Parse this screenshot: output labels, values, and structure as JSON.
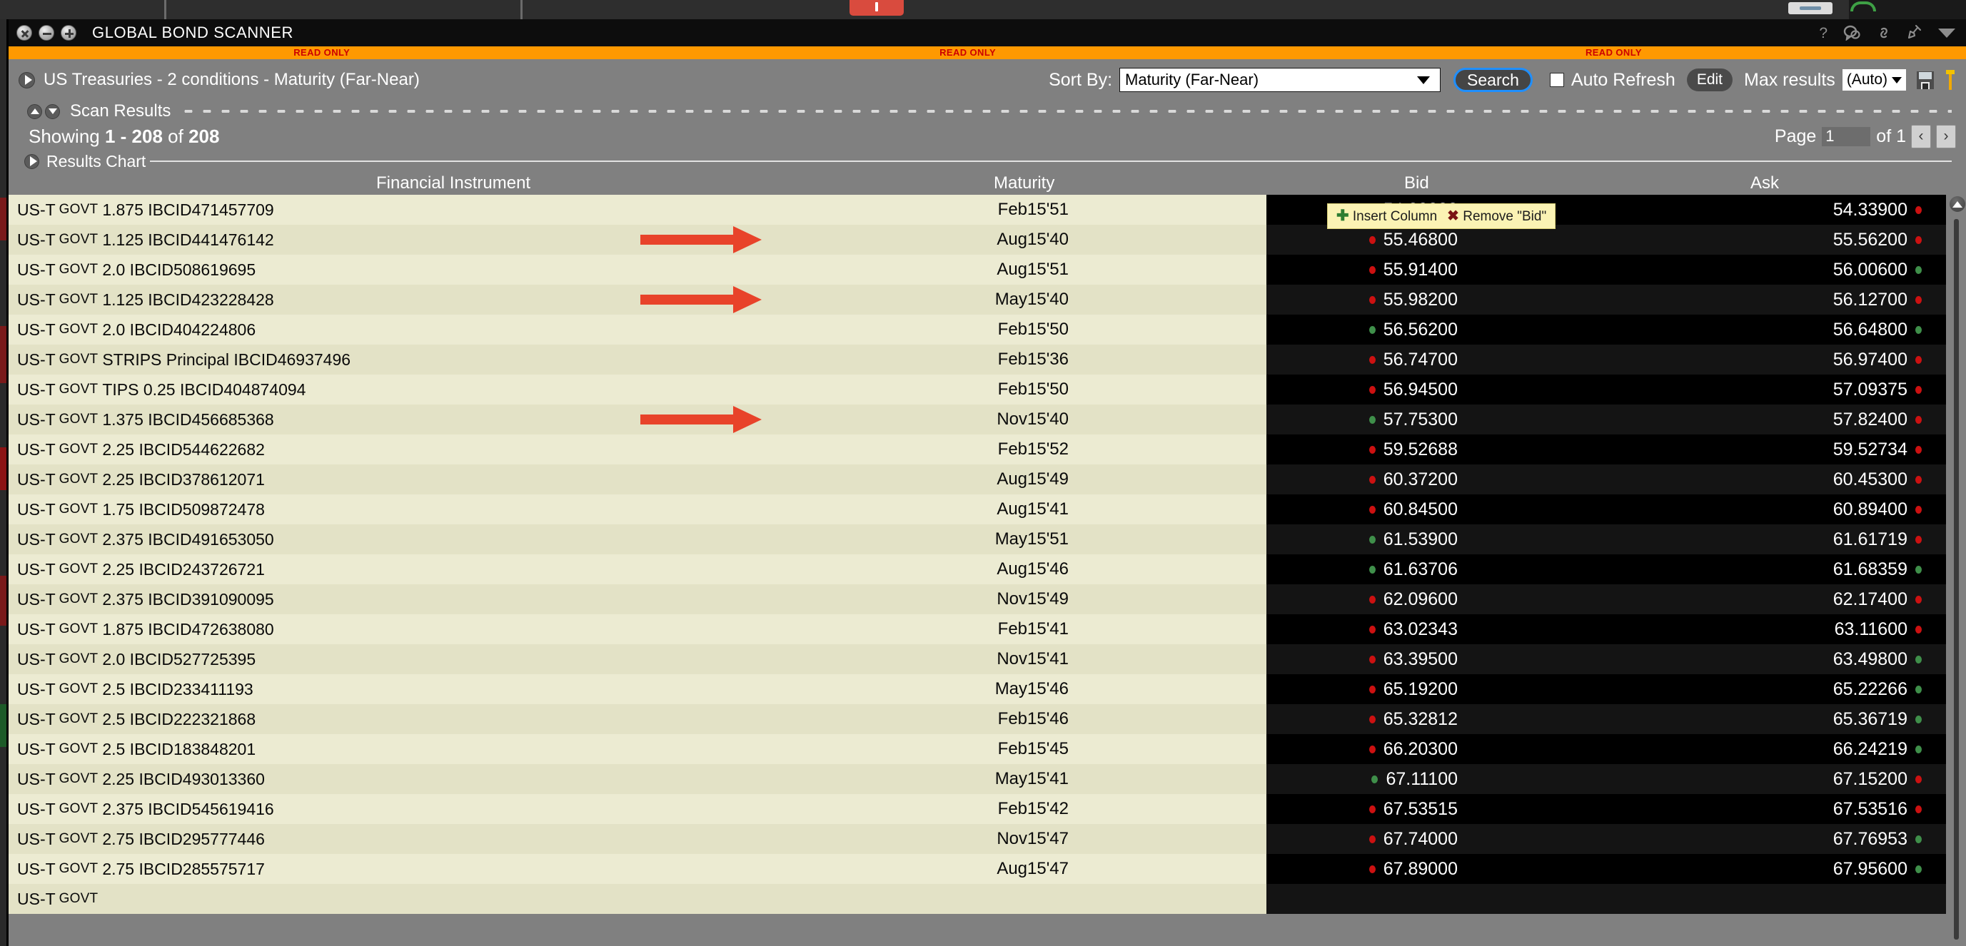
{
  "window": {
    "title": "GLOBAL BOND SCANNER",
    "readonly_label": "READ ONLY",
    "titlebar_icons": [
      "help-icon",
      "chat-icon",
      "link-icon",
      "pin-icon",
      "chevron-down-icon"
    ]
  },
  "toolbar": {
    "scan_title": "US Treasuries - 2 conditions - Maturity (Far-Near)",
    "sort_label": "Sort By:",
    "sort_value": "Maturity (Far-Near)",
    "search_label": "Search",
    "auto_refresh_label": "Auto Refresh",
    "auto_refresh_checked": false,
    "edit_label": "Edit",
    "max_results_label": "Max results",
    "max_results_value": "(Auto)"
  },
  "scan": {
    "results_label": "Scan Results",
    "showing_prefix": "Showing ",
    "showing_range": "1 - 208",
    "showing_mid": " of ",
    "showing_total": "208",
    "chart_label": "Results Chart"
  },
  "pagination": {
    "page_label": "Page",
    "page_value": "1",
    "of_label": "of 1",
    "prev_glyph": "‹",
    "next_glyph": "›"
  },
  "tooltip": {
    "insert_label": "Insert Column",
    "remove_label": "Remove \"Bid\"",
    "plus_glyph": "✚",
    "x_glyph": "✖"
  },
  "table": {
    "headers": {
      "instrument": "Financial Instrument",
      "maturity": "Maturity",
      "bid": "Bid",
      "ask": "Ask"
    },
    "rows": [
      {
        "prefix": "US-T",
        "kind": "GOVT",
        "rest": "1.875 IBCID471457709",
        "maturity": "Feb15'51",
        "bid": "54.29000",
        "bid_dir": "down",
        "ask": "54.33900",
        "ask_dir": "down"
      },
      {
        "prefix": "US-T",
        "kind": "GOVT",
        "rest": "1.125 IBCID441476142",
        "maturity": "Aug15'40",
        "bid": "55.46800",
        "bid_dir": "down",
        "ask": "55.56200",
        "ask_dir": "down"
      },
      {
        "prefix": "US-T",
        "kind": "GOVT",
        "rest": "2.0 IBCID508619695",
        "maturity": "Aug15'51",
        "bid": "55.91400",
        "bid_dir": "down",
        "ask": "56.00600",
        "ask_dir": "up"
      },
      {
        "prefix": "US-T",
        "kind": "GOVT",
        "rest": "1.125 IBCID423228428",
        "maturity": "May15'40",
        "bid": "55.98200",
        "bid_dir": "down",
        "ask": "56.12700",
        "ask_dir": "down"
      },
      {
        "prefix": "US-T",
        "kind": "GOVT",
        "rest": "2.0 IBCID404224806",
        "maturity": "Feb15'50",
        "bid": "56.56200",
        "bid_dir": "up",
        "ask": "56.64800",
        "ask_dir": "up"
      },
      {
        "prefix": "US-T",
        "kind": "GOVT",
        "rest": "STRIPS Principal IBCID46937496",
        "maturity": "Feb15'36",
        "bid": "56.74700",
        "bid_dir": "down",
        "ask": "56.97400",
        "ask_dir": "down"
      },
      {
        "prefix": "US-T",
        "kind": "GOVT",
        "rest": "TIPS 0.25 IBCID404874094",
        "maturity": "Feb15'50",
        "bid": "56.94500",
        "bid_dir": "down",
        "ask": "57.09375",
        "ask_dir": "down"
      },
      {
        "prefix": "US-T",
        "kind": "GOVT",
        "rest": "1.375 IBCID456685368",
        "maturity": "Nov15'40",
        "bid": "57.75300",
        "bid_dir": "up",
        "ask": "57.82400",
        "ask_dir": "down"
      },
      {
        "prefix": "US-T",
        "kind": "GOVT",
        "rest": "2.25 IBCID544622682",
        "maturity": "Feb15'52",
        "bid": "59.52688",
        "bid_dir": "down",
        "ask": "59.52734",
        "ask_dir": "down"
      },
      {
        "prefix": "US-T",
        "kind": "GOVT",
        "rest": "2.25 IBCID378612071",
        "maturity": "Aug15'49",
        "bid": "60.37200",
        "bid_dir": "down",
        "ask": "60.45300",
        "ask_dir": "down"
      },
      {
        "prefix": "US-T",
        "kind": "GOVT",
        "rest": "1.75 IBCID509872478",
        "maturity": "Aug15'41",
        "bid": "60.84500",
        "bid_dir": "down",
        "ask": "60.89400",
        "ask_dir": "down"
      },
      {
        "prefix": "US-T",
        "kind": "GOVT",
        "rest": "2.375 IBCID491653050",
        "maturity": "May15'51",
        "bid": "61.53900",
        "bid_dir": "up",
        "ask": "61.61719",
        "ask_dir": "down"
      },
      {
        "prefix": "US-T",
        "kind": "GOVT",
        "rest": "2.25 IBCID243726721",
        "maturity": "Aug15'46",
        "bid": "61.63706",
        "bid_dir": "up",
        "ask": "61.68359",
        "ask_dir": "up"
      },
      {
        "prefix": "US-T",
        "kind": "GOVT",
        "rest": "2.375 IBCID391090095",
        "maturity": "Nov15'49",
        "bid": "62.09600",
        "bid_dir": "down",
        "ask": "62.17400",
        "ask_dir": "down"
      },
      {
        "prefix": "US-T",
        "kind": "GOVT",
        "rest": "1.875 IBCID472638080",
        "maturity": "Feb15'41",
        "bid": "63.02343",
        "bid_dir": "down",
        "ask": "63.11600",
        "ask_dir": "down"
      },
      {
        "prefix": "US-T",
        "kind": "GOVT",
        "rest": "2.0 IBCID527725395",
        "maturity": "Nov15'41",
        "bid": "63.39500",
        "bid_dir": "down",
        "ask": "63.49800",
        "ask_dir": "up"
      },
      {
        "prefix": "US-T",
        "kind": "GOVT",
        "rest": "2.5 IBCID233411193",
        "maturity": "May15'46",
        "bid": "65.19200",
        "bid_dir": "down",
        "ask": "65.22266",
        "ask_dir": "up"
      },
      {
        "prefix": "US-T",
        "kind": "GOVT",
        "rest": "2.5 IBCID222321868",
        "maturity": "Feb15'46",
        "bid": "65.32812",
        "bid_dir": "down",
        "ask": "65.36719",
        "ask_dir": "up"
      },
      {
        "prefix": "US-T",
        "kind": "GOVT",
        "rest": "2.5 IBCID183848201",
        "maturity": "Feb15'45",
        "bid": "66.20300",
        "bid_dir": "down",
        "ask": "66.24219",
        "ask_dir": "up"
      },
      {
        "prefix": "US-T",
        "kind": "GOVT",
        "rest": "2.25 IBCID493013360",
        "maturity": "May15'41",
        "bid": "67.11100",
        "bid_dir": "up",
        "ask": "67.15200",
        "ask_dir": "down"
      },
      {
        "prefix": "US-T",
        "kind": "GOVT",
        "rest": "2.375 IBCID545619416",
        "maturity": "Feb15'42",
        "bid": "67.53515",
        "bid_dir": "down",
        "ask": "67.53516",
        "ask_dir": "down"
      },
      {
        "prefix": "US-T",
        "kind": "GOVT",
        "rest": "2.75 IBCID295777446",
        "maturity": "Nov15'47",
        "bid": "67.74000",
        "bid_dir": "down",
        "ask": "67.76953",
        "ask_dir": "up"
      },
      {
        "prefix": "US-T",
        "kind": "GOVT",
        "rest": "2.75 IBCID285575717",
        "maturity": "Aug15'47",
        "bid": "67.89000",
        "bid_dir": "down",
        "ask": "67.95600",
        "ask_dir": "up"
      },
      {
        "prefix": "US-T",
        "kind": "GOVT",
        "rest": "",
        "maturity": "",
        "bid": "",
        "bid_dir": "down",
        "ask": "",
        "ask_dir": "down"
      }
    ],
    "annotated_rows": [
      1,
      3,
      7
    ]
  },
  "colors": {
    "accent_orange": "#ff9900",
    "readonly_red": "#cc0000",
    "row_light": "#ecebd2",
    "row_light_alt": "#e3e2c6",
    "focus_blue": "#1f8fff",
    "up_green": "#3f8f4a",
    "down_red": "#cc1111",
    "annotation_red": "#e8432a"
  }
}
